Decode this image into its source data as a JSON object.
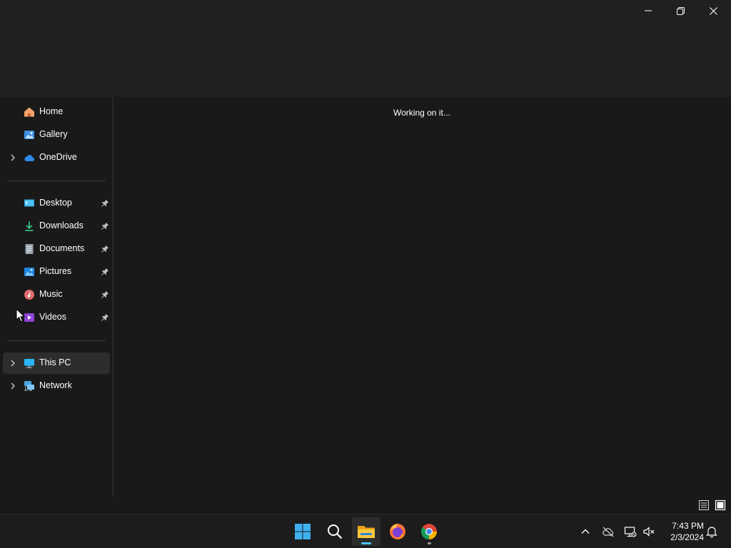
{
  "window": {
    "caption_buttons": [
      "minimize-icon",
      "restore-icon",
      "close-icon"
    ]
  },
  "nav": {
    "quick": [
      {
        "label": "Home",
        "icon": "home-icon"
      },
      {
        "label": "Gallery",
        "icon": "gallery-icon"
      },
      {
        "label": "OneDrive",
        "icon": "cloud-icon",
        "expandable": true
      }
    ],
    "pinned": [
      {
        "label": "Desktop",
        "icon": "desktop-folder-icon"
      },
      {
        "label": "Downloads",
        "icon": "download-icon"
      },
      {
        "label": "Documents",
        "icon": "documents-icon"
      },
      {
        "label": "Pictures",
        "icon": "pictures-icon"
      },
      {
        "label": "Music",
        "icon": "music-icon"
      },
      {
        "label": "Videos",
        "icon": "videos-icon"
      }
    ],
    "devices": [
      {
        "label": "This PC",
        "icon": "computer-icon",
        "expandable": true,
        "selected": true
      },
      {
        "label": "Network",
        "icon": "network-icon",
        "expandable": true
      }
    ]
  },
  "content": {
    "status_message": "Working on it..."
  },
  "statusbar": {
    "views": [
      "details-view-icon",
      "large-icons-view-icon"
    ]
  },
  "taskbar": {
    "apps": [
      {
        "name": "start-icon"
      },
      {
        "name": "search-icon"
      },
      {
        "name": "file-explorer-icon",
        "active": true
      },
      {
        "name": "firefox-icon"
      },
      {
        "name": "chrome-icon",
        "running": true
      }
    ],
    "tray": [
      "chevron-up-icon",
      "onedrive-offline-icon",
      "network-disconnected-icon",
      "volume-muted-icon"
    ],
    "time": "7:43 PM",
    "date": "2/3/2024"
  },
  "colors": {
    "accent": "#4cc2ff",
    "background": "#191919",
    "chrome": "#202020"
  }
}
